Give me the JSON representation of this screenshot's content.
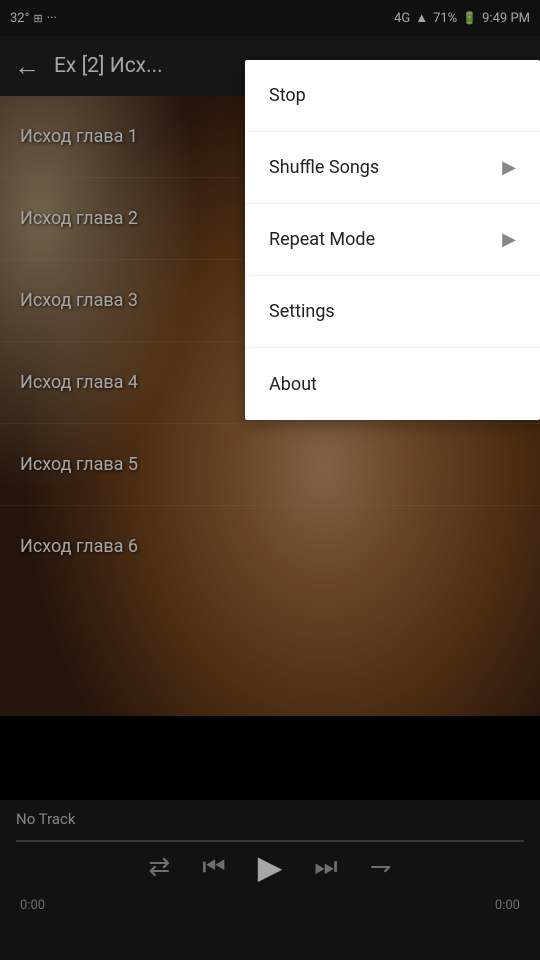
{
  "status_bar": {
    "temp": "32°",
    "battery_percent": "71%",
    "time": "9:49 PM",
    "network": "4G"
  },
  "nav": {
    "back_label": "←",
    "title": "Ex [2] Исх..."
  },
  "songs": [
    {
      "id": 1,
      "label": "Исход глава 1"
    },
    {
      "id": 2,
      "label": "Исход глава 2"
    },
    {
      "id": 3,
      "label": "Исход глава 3"
    },
    {
      "id": 4,
      "label": "Исход глава 4"
    },
    {
      "id": 5,
      "label": "Исход глава 5"
    },
    {
      "id": 6,
      "label": "Исход глава 6"
    }
  ],
  "player": {
    "track_name": "No Track",
    "time_current": "0:00",
    "time_total": "0:00"
  },
  "dropdown": {
    "items": [
      {
        "id": "stop",
        "label": "Stop",
        "has_arrow": false
      },
      {
        "id": "shuffle",
        "label": "Shuffle Songs",
        "has_arrow": true
      },
      {
        "id": "repeat",
        "label": "Repeat Mode",
        "has_arrow": true
      },
      {
        "id": "settings",
        "label": "Settings",
        "has_arrow": false
      },
      {
        "id": "about",
        "label": "About",
        "has_arrow": false
      }
    ]
  }
}
